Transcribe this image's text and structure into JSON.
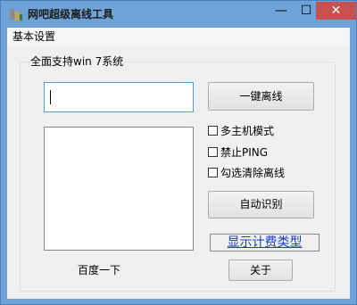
{
  "window": {
    "title": "网吧超级离线工具",
    "minimize": "—",
    "maximize": "☐",
    "close": "✕",
    "icon": "app-icon"
  },
  "menu": {
    "items": [
      "基本设置"
    ]
  },
  "group": {
    "title": "全面支持win 7系统"
  },
  "buttons": {
    "offline": "一键离线",
    "detect": "自动识别",
    "about": "关于"
  },
  "checkboxes": [
    {
      "label": "多主机模式",
      "checked": false
    },
    {
      "label": "禁止PING",
      "checked": false
    },
    {
      "label": "勾选清除离线",
      "checked": false
    }
  ],
  "link": {
    "label": "显示计费类型",
    "color": "#1c3ccf"
  },
  "static": {
    "baidu": "百度一下"
  },
  "input": {
    "value": ""
  },
  "colors": {
    "titlebar": "#6fa2d7",
    "close": "#c75050",
    "client": "#f0f0f0"
  }
}
